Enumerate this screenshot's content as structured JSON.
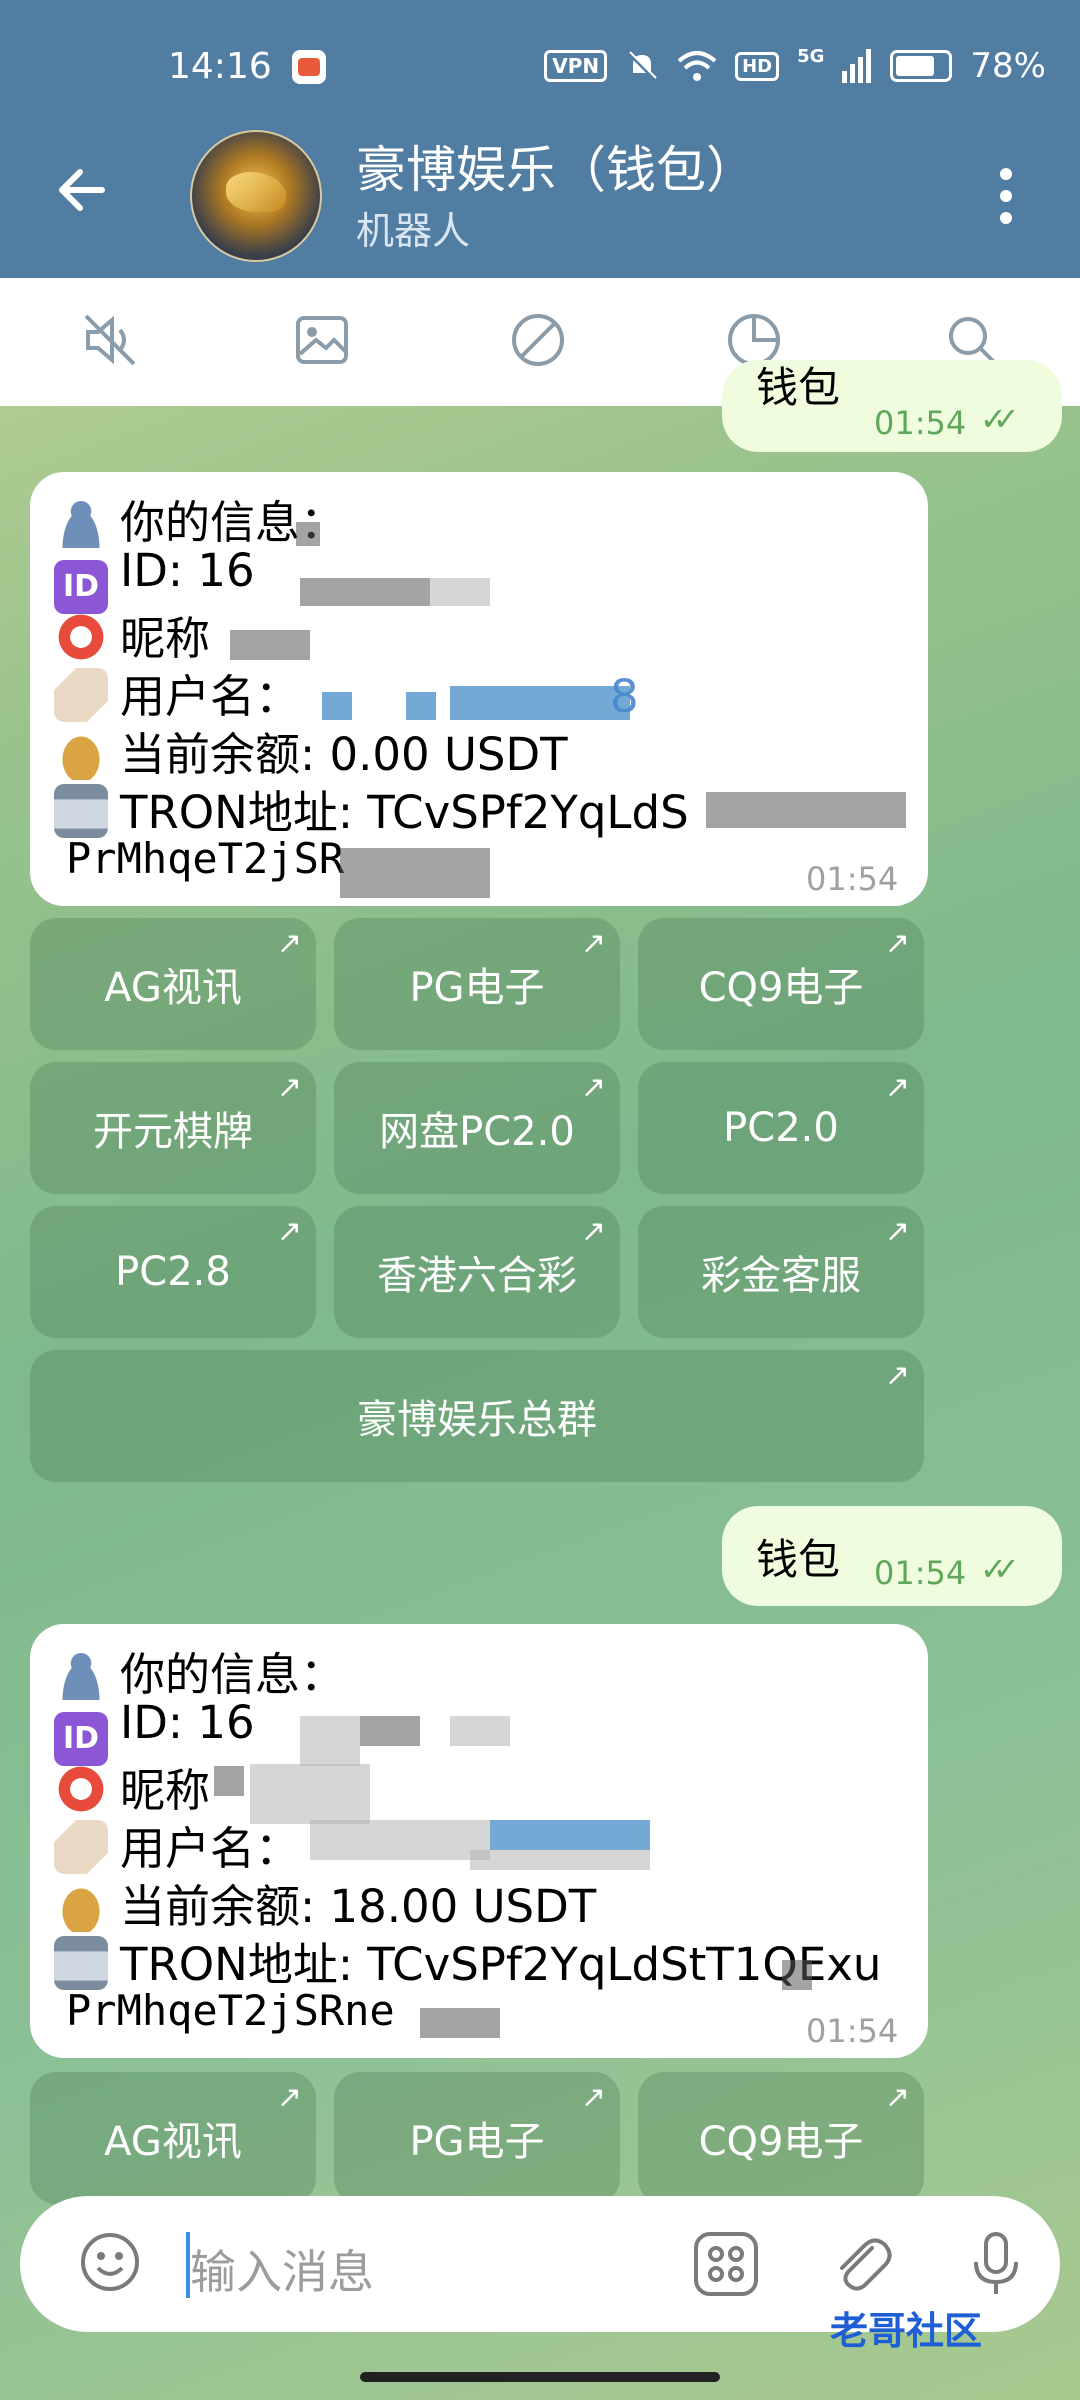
{
  "status": {
    "time": "14:16",
    "vpn": "VPN",
    "hd": "HD",
    "network": "5G",
    "battery": "78%"
  },
  "header": {
    "title": "豪博娱乐（钱包）",
    "subtitle": "机器人"
  },
  "toolbar": {
    "icons": [
      "mute-icon",
      "image-icon",
      "block-icon",
      "stats-icon",
      "search-icon"
    ]
  },
  "messages": [
    {
      "type": "out",
      "text": "钱包",
      "time": "01:54"
    },
    {
      "type": "in",
      "lines": {
        "info": "你的信息：",
        "id": "ID: 16",
        "nick": "昵称",
        "username": "用户名：",
        "username_tail": "8",
        "balance": "当前余额: 0.00 USDT",
        "tron1": "TRON地址: TCvSPf2YqLdS",
        "tron2": "PrMhqeT2jSR"
      },
      "time": "01:54"
    },
    {
      "type": "out",
      "text": "钱包",
      "time": "01:54"
    },
    {
      "type": "in",
      "lines": {
        "info": "你的信息：",
        "id": "ID: 16",
        "nick": "昵称",
        "username": "用户名：",
        "balance": "当前余额: 18.00 USDT",
        "tron1": "TRON地址: TCvSPf2YqLdStT1QExu",
        "tron2": "PrMhqeT2jSRne"
      },
      "time": "01:54"
    }
  ],
  "keyboard": {
    "rows": [
      [
        "AG视讯",
        "PG电子",
        "CQ9电子"
      ],
      [
        "开元棋牌",
        "网盘PC2.0",
        "PC2.0"
      ],
      [
        "PC2.8",
        "香港六合彩",
        "彩金客服"
      ],
      [
        "豪博娱乐总群"
      ]
    ],
    "second_rows": [
      [
        "AG视讯",
        "PG电子",
        "CQ9电子"
      ]
    ],
    "arrow": "↗"
  },
  "input": {
    "placeholder": "输入消息"
  },
  "watermark": "老哥社区",
  "colors": {
    "header": "#517da2",
    "outgoing": "#effdde",
    "check": "#5fa75a"
  }
}
